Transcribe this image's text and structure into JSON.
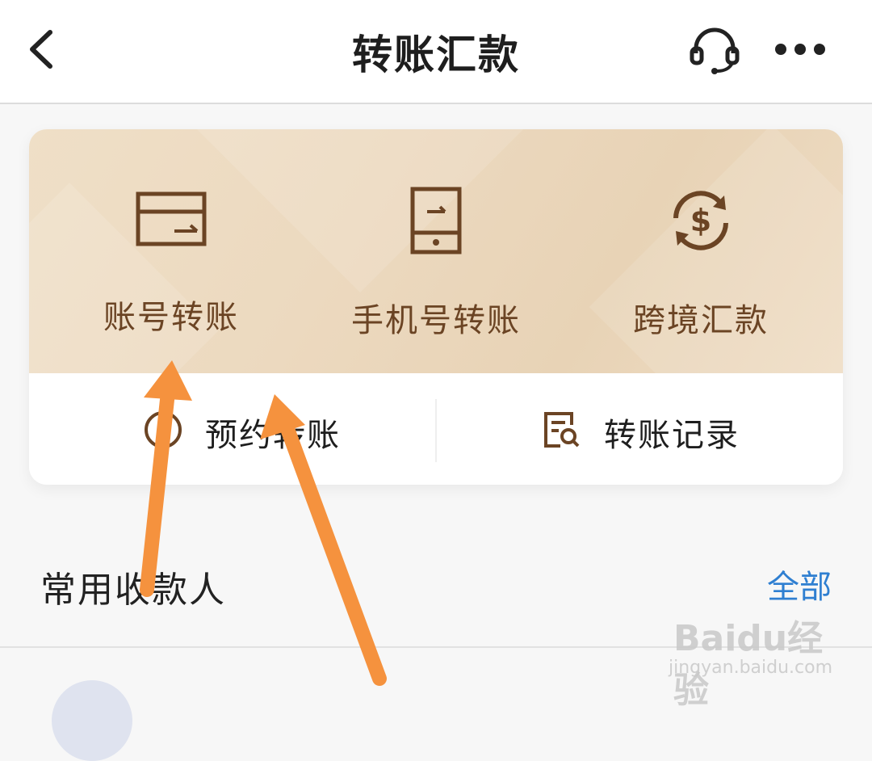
{
  "header": {
    "title": "转账汇款",
    "back_icon": "chevron-left-icon",
    "support_icon": "headset-icon",
    "more_icon": "more-dots-icon"
  },
  "features": [
    {
      "label": "账号转账",
      "icon": "bank-card-icon"
    },
    {
      "label": "手机号转账",
      "icon": "mobile-phone-icon"
    },
    {
      "label": "跨境汇款",
      "icon": "currency-exchange-icon"
    }
  ],
  "sub_actions": [
    {
      "label": "预约转账",
      "icon": "clock-icon"
    },
    {
      "label": "转账记录",
      "icon": "record-search-icon"
    }
  ],
  "payees": {
    "title": "常用收款人",
    "view_all": "全部"
  },
  "watermark": {
    "brand": "Baidu经验",
    "url": "jingyan.baidu.com"
  },
  "colors": {
    "accent_brown": "#6b4424",
    "link_blue": "#2f7fd1",
    "annotation_arrow": "#f5923e"
  }
}
